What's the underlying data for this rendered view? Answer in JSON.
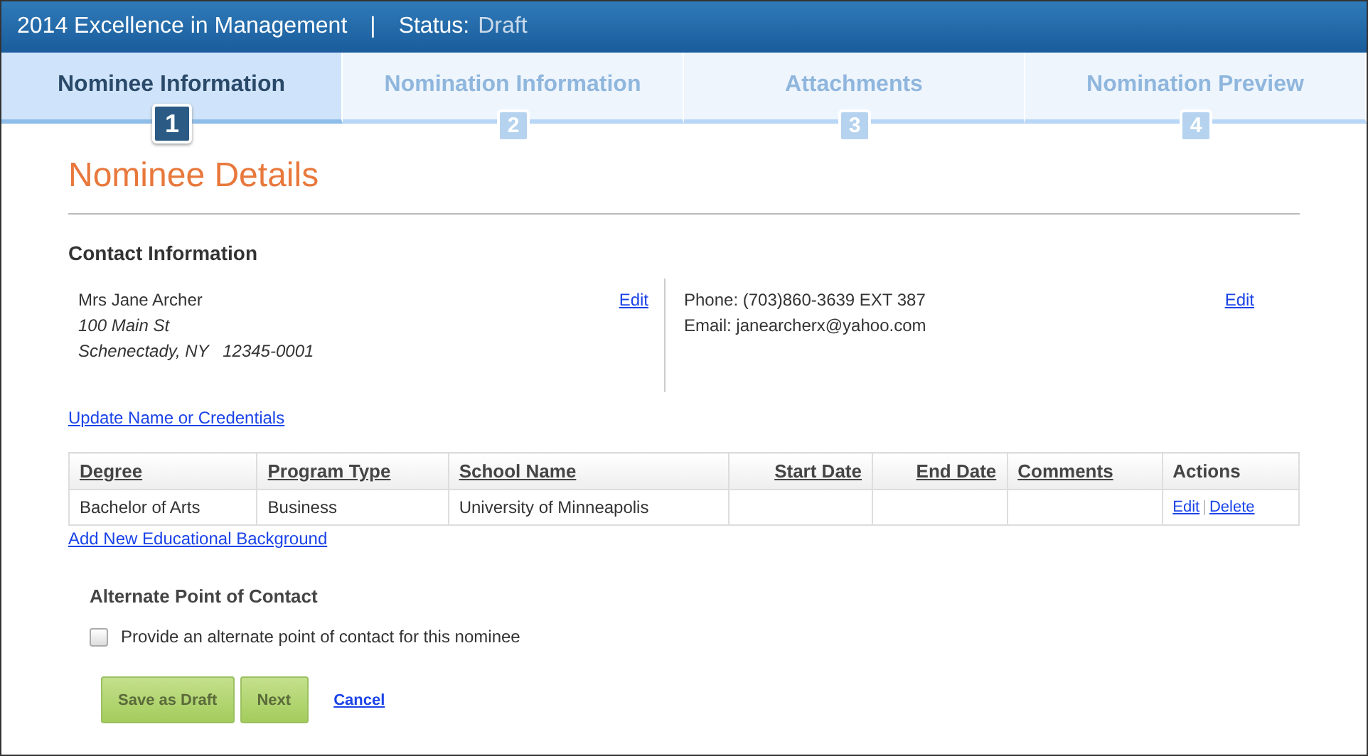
{
  "header": {
    "title": "2014 Excellence in Management",
    "separator": "|",
    "status_label": "Status:",
    "status_value": "Draft"
  },
  "steps": [
    {
      "label": "Nominee Information",
      "number": "1",
      "selected": true
    },
    {
      "label": "Nomination Information",
      "number": "2",
      "selected": false
    },
    {
      "label": "Attachments",
      "number": "3",
      "selected": false
    },
    {
      "label": "Nomination Preview",
      "number": "4",
      "selected": false
    }
  ],
  "page_title": "Nominee Details",
  "contact": {
    "heading": "Contact Information",
    "name": "Mrs Jane Archer",
    "address": "100 Main St",
    "city": "Schenectady, NY   12345-0001",
    "edit_left": "Edit",
    "phone": "Phone: (703)860-3639 EXT 387",
    "email": "Email: janearcherx@yahoo.com",
    "edit_right": "Edit",
    "update_link": "Update Name or Credentials"
  },
  "education": {
    "columns": [
      {
        "label": "Degree",
        "kind": "text",
        "sortable": true
      },
      {
        "label": "Program Type",
        "kind": "text",
        "sortable": true
      },
      {
        "label": "School Name",
        "kind": "text",
        "sortable": true
      },
      {
        "label": "Start Date",
        "kind": "date",
        "sortable": true
      },
      {
        "label": "End Date",
        "kind": "date",
        "sortable": true
      },
      {
        "label": "Comments",
        "kind": "text",
        "sortable": true
      },
      {
        "label": "Actions",
        "kind": "text",
        "sortable": false
      }
    ],
    "rows": [
      {
        "cells": [
          "Bachelor of Arts",
          "Business",
          "University of Minneapolis",
          "",
          "",
          ""
        ],
        "actions": [
          "Edit",
          "Delete"
        ],
        "action_separator": "|"
      }
    ],
    "add_link": "Add New Educational Background"
  },
  "alternate": {
    "heading": "Alternate Point of Contact",
    "checkbox_label": "Provide an alternate point of contact for this nominee",
    "checked": false
  },
  "buttons": [
    {
      "label": "Save as Draft",
      "kind": "button"
    },
    {
      "label": "Next",
      "kind": "button"
    },
    {
      "label": "Cancel",
      "kind": "link"
    }
  ]
}
